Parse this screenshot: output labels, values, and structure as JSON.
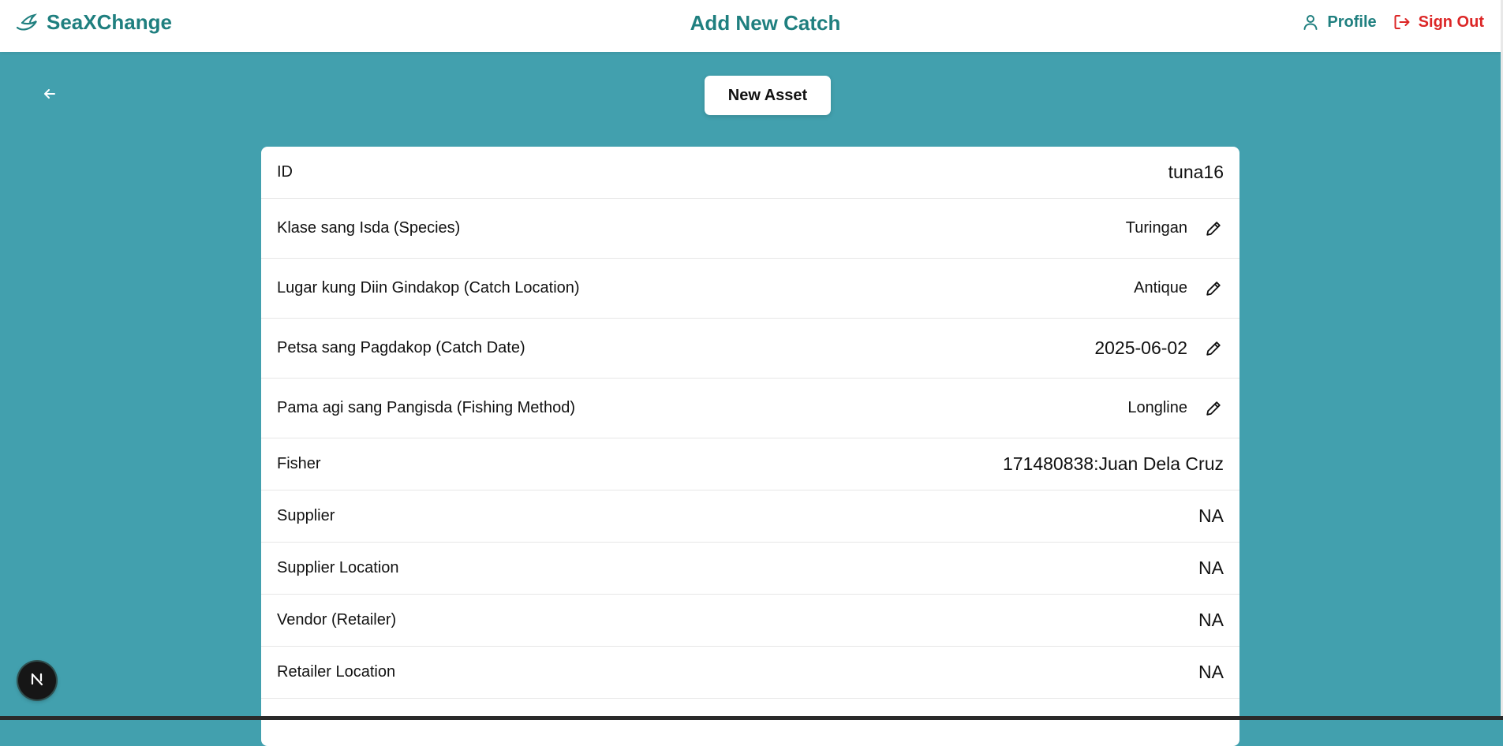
{
  "header": {
    "brand": "SeaXChange",
    "title": "Add New Catch",
    "profile_label": "Profile",
    "signout_label": "Sign Out",
    "brand_color": "#1f7f7f",
    "signout_color": "#dc2626"
  },
  "toolbar": {
    "new_asset_label": "New Asset",
    "back_icon": "arrow-left-icon"
  },
  "asset": {
    "id_label": "ID",
    "id_value": "tuna16",
    "species_label": "Klase sang Isda (Species)",
    "species_value": "Turingan",
    "location_label": "Lugar kung Diin Gindakop (Catch Location)",
    "location_value": "Antique",
    "date_label": "Petsa sang Pagdakop (Catch Date)",
    "date_value": "2025-06-02",
    "method_label": "Pama agi sang Pangisda (Fishing Method)",
    "method_value": "Longline",
    "fisher_label": "Fisher",
    "fisher_value": "171480838:Juan Dela Cruz",
    "supplier_label": "Supplier",
    "supplier_value": "NA",
    "supplier_location_label": "Supplier Location",
    "supplier_location_value": "NA",
    "vendor_label": "Vendor (Retailer)",
    "vendor_value": "NA",
    "retailer_location_label": "Retailer Location",
    "retailer_location_value": "NA"
  },
  "colors": {
    "page_background": "#42a0ae",
    "card_background": "#ffffff"
  },
  "dev_badge": {
    "icon": "nextjs-icon"
  }
}
